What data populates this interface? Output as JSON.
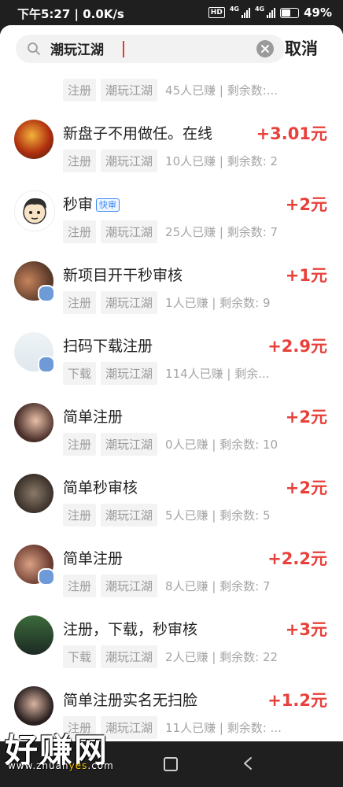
{
  "statusbar": {
    "time": "下午5:27",
    "speed": "0.0K/s",
    "hd": "HD",
    "net1": "4G",
    "net2": "4G",
    "battery": "49%"
  },
  "search": {
    "query": "潮玩江湖",
    "cancel": "取消"
  },
  "items": [
    {
      "title": "",
      "price": "",
      "tag1": "注册",
      "tag2": "潮玩江湖",
      "stats": "45人已赚 | 剩余数:..."
    },
    {
      "title": "新盘子不用做任。在线",
      "price": "+3.01元",
      "tag1": "注册",
      "tag2": "潮玩江湖",
      "stats": "10人已赚 | 剩余数: 2"
    },
    {
      "title": "秒审",
      "badge": "快审",
      "price": "+2元",
      "tag1": "注册",
      "tag2": "潮玩江湖",
      "stats": "25人已赚 | 剩余数: 7"
    },
    {
      "title": "新项目开干秒审核",
      "price": "+1元",
      "tag1": "注册",
      "tag2": "潮玩江湖",
      "stats": "1人已赚 | 剩余数: 9"
    },
    {
      "title": "扫码下载注册",
      "price": "+2.9元",
      "tag1": "下载",
      "tag2": "潮玩江湖",
      "stats": "114人已赚 | 剩余..."
    },
    {
      "title": "简单注册",
      "price": "+2元",
      "tag1": "注册",
      "tag2": "潮玩江湖",
      "stats": "0人已赚 | 剩余数: 10"
    },
    {
      "title": "简单秒审核",
      "price": "+2元",
      "tag1": "注册",
      "tag2": "潮玩江湖",
      "stats": "5人已赚 | 剩余数: 5"
    },
    {
      "title": "简单注册",
      "price": "+2.2元",
      "tag1": "注册",
      "tag2": "潮玩江湖",
      "stats": "8人已赚 | 剩余数: 7"
    },
    {
      "title": "注册，下载，秒审核",
      "price": "+3元",
      "tag1": "下载",
      "tag2": "潮玩江湖",
      "stats": "2人已赚 | 剩余数: 22"
    },
    {
      "title": "简单注册实名无扫脸",
      "price": "+1.2元",
      "tag1": "注册",
      "tag2": "潮玩江湖",
      "stats": "11人已赚 | 剩余数: ..."
    }
  ],
  "watermark": {
    "text": "好赚网",
    "url_a": "www.zhuan",
    "url_b": "yes",
    "url_c": ".com"
  },
  "colors": {
    "price": "#e8403a",
    "badge": "#3d8af7",
    "status_bg": "#1f1f1f"
  }
}
